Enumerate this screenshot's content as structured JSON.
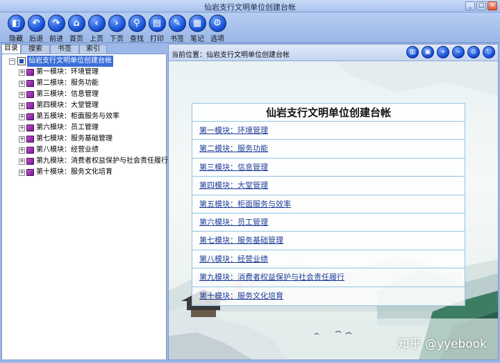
{
  "window": {
    "title": "仙岩支行文明单位创建台帐",
    "minimize": "_",
    "maximize": "□",
    "close": "×"
  },
  "toolbar": [
    {
      "label": "隐藏",
      "icon": "hide-icon",
      "glyph": "◧"
    },
    {
      "label": "后退",
      "icon": "back-icon",
      "glyph": "↶"
    },
    {
      "label": "前进",
      "icon": "forward-icon",
      "glyph": "↷"
    },
    {
      "label": "首页",
      "icon": "home-icon",
      "glyph": "⌂"
    },
    {
      "label": "上页",
      "icon": "prev-page-icon",
      "glyph": "‹"
    },
    {
      "label": "下页",
      "icon": "next-page-icon",
      "glyph": "›"
    },
    {
      "label": "查找",
      "icon": "find-icon",
      "glyph": "⚲"
    },
    {
      "label": "打印",
      "icon": "print-icon",
      "glyph": "▤"
    },
    {
      "label": "书签",
      "icon": "bookmark-icon",
      "glyph": "✎"
    },
    {
      "label": "笔记",
      "icon": "note-icon",
      "glyph": "▦"
    },
    {
      "label": "选项",
      "icon": "options-icon",
      "glyph": "⚙"
    }
  ],
  "tabs": [
    "目录",
    "搜索",
    "书签",
    "索引"
  ],
  "tree": {
    "root": "仙岩支行文明单位创建台帐",
    "items": [
      "第一模块：环境管理",
      "第二模块：服务功能",
      "第三模块：信息管理",
      "第四模块：大堂管理",
      "第五模块：柜面服务与效率",
      "第六模块：员工管理",
      "第七模块：服务基础管理",
      "第八模块：经营业绩",
      "第九模块：消费者权益保护与社会责任履行",
      "第十模块：服务文化培育"
    ],
    "expander": "+",
    "root_expander": "−"
  },
  "location": {
    "label": "当前位置：",
    "value": "仙岩支行文明单位创建台帐"
  },
  "location_buttons": [
    {
      "icon": "contents-icon",
      "glyph": "▥"
    },
    {
      "icon": "fullscreen-icon",
      "glyph": "▣"
    },
    {
      "icon": "zoom-in-icon",
      "glyph": "+"
    },
    {
      "icon": "zoom-out-icon",
      "glyph": "−"
    },
    {
      "icon": "zoom-fit-icon",
      "glyph": "⊙"
    },
    {
      "icon": "exit-icon",
      "glyph": "⎋"
    }
  ],
  "panel": {
    "title": "仙岩支行文明单位创建台帐",
    "links": [
      "第一模块：环境管理",
      "第二模块：服务功能",
      "第三模块：信息管理",
      "第四模块：大堂管理",
      "第五模块：柜面服务与效率",
      "第六模块：员工管理",
      "第七模块：服务基础管理",
      "第八模块：经营业绩",
      "第九模块：消费者权益保护与社会责任履行",
      "第十模块：服务文化培育"
    ]
  },
  "watermark": "知乎 @yyebook"
}
